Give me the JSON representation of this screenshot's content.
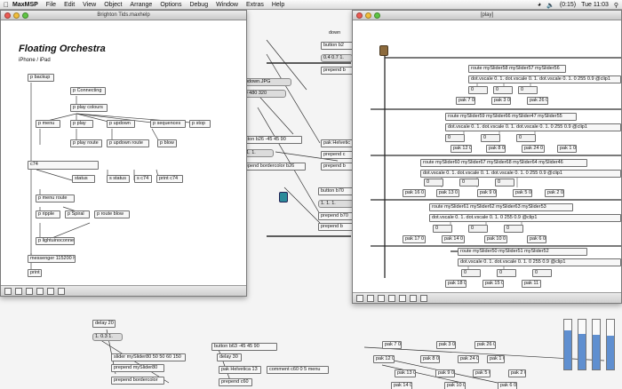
{
  "menubar": {
    "app_name": "MaxMSP",
    "items": [
      "File",
      "Edit",
      "View",
      "Object",
      "Arrange",
      "Options",
      "Debug",
      "Window",
      "Extras",
      "Help"
    ],
    "battery": "(0:15)",
    "clock": "Tue 11:03"
  },
  "help_window": {
    "title": "Brighton Tids.maxhelp",
    "heading": "Floating Orchestra",
    "subheading": "iPhone / iPad",
    "objects": [
      "p backup",
      "p Connecting",
      "p play colours",
      "p menu",
      "p play",
      "p updown",
      "p sequences",
      "p stop",
      "p play route",
      "p updown route",
      "p blow",
      "c74",
      "status",
      "s status",
      "s c74",
      "print c74",
      "p menu route",
      "p ripple",
      "p Spiral",
      "p route blow",
      "p lightuinoconnect",
      "messenger 115200 h",
      "print"
    ]
  },
  "play_window": {
    "title": "[play]",
    "rows": [
      {
        "route": "route mySlider58 mySlider57 mySlider56",
        "scale": "dot.vscale 0. 1. dot.vscale 0. 1. dot.vscale 0. 1. 0 255 0.9 @clip1",
        "paks": [
          "pak 7 0",
          "pak 3 0",
          "pak 26 0"
        ]
      },
      {
        "route": "route mySlider59 mySlider66 mySlider47 mySlider55",
        "scale": "dot.vscale 0. 1. dot.vscale 0. 1. dot.vscale 0. 1. 0 255 0.9 @clip1",
        "paks": [
          "pak 12 0",
          "pak 8 0",
          "pak 24 0",
          "pak 1 0"
        ]
      },
      {
        "route": "route mySlider60 mySlider67 mySlider68 mySlider64 mySlider46",
        "scale": "dot.vscale 0. 1. dot.vscale 0. 1. dot.vscale 0. 1. 0 255 0.9 @clip1",
        "paks": [
          "pak 16 0",
          "pak 13 0",
          "pak 9 0",
          "pak 5 0",
          "pak 2 0"
        ]
      },
      {
        "route": "route mySlider61 mySlider62 mySlider63 mySlider53",
        "scale": "dot.vscale 0. 1. dot.vscale 0. 1. 0 255 0.9 @clip1",
        "paks": [
          "pak 17 0",
          "pak 14 0",
          "pak 10 0",
          "pak 6 0"
        ]
      },
      {
        "route": "route mySlider50 mySlider51 mySlider52",
        "scale": "dot.vscale 0. 1. dot.vscale 0. 1. 0 255 0.9 @clip1",
        "paks": [
          "pak 18 0",
          "pak 15 0",
          "pak 11 0"
        ]
      }
    ],
    "zero_box": "0"
  },
  "middle_patch": {
    "objects": [
      "down",
      "button b2",
      "0.4 0.7 1.",
      "prepend b",
      "stop/updown.JPG",
      "0 0 480 320",
      "button b26 -45 45 90",
      "1. 1. 1.",
      "prepend bordercolor b26",
      "pak Helvetic",
      "prepend c",
      "prepend b",
      "button b70",
      "1. 1. 1.",
      "prepend b70",
      "prepend b"
    ]
  },
  "lower_patch": {
    "objects": [
      "delay 20",
      "1. 0.3 1.",
      "slider mySlider80 50 50 60 150",
      "prepend mySlider80",
      "prepend bordercolor",
      "button b63 -45 45 90",
      "delay 30",
      "pak Helvetica 13",
      "comment c60 0 5 menu",
      "prepend c60"
    ],
    "right_rows": [
      [
        "pak 7 0",
        "pak 3 0",
        "pak 26 0"
      ],
      [
        "pak 12 0",
        "pak 8 0",
        "pak 24 0",
        "pak 1 0"
      ],
      [
        "pak 13 0",
        "pak 9 0",
        "pak 5 0",
        "pak 2 0"
      ],
      [
        "pak 14 0",
        "pak 10 0",
        "pak 6 0"
      ]
    ]
  },
  "sliders": {
    "fills": [
      0.78,
      0.72,
      0.7,
      0.68
    ],
    "color": "#5f8fd0"
  },
  "colors": {
    "accent": "#5f8fd0",
    "window_bg": "#ffffff",
    "object_border": "#6f6f6f"
  }
}
